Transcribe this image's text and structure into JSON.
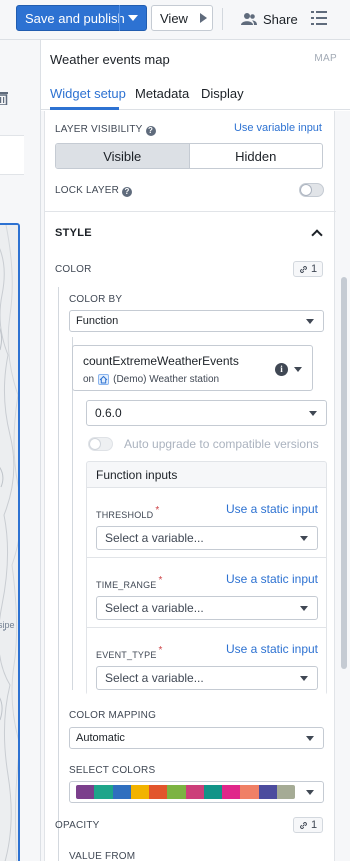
{
  "toolbar": {
    "save_publish_label": "Save and publish",
    "view_label": "View",
    "share_label": "Share"
  },
  "map": {
    "partial_label": "sipe"
  },
  "panel": {
    "title": "Weather events map",
    "kind": "MAP",
    "tabs": [
      {
        "label": "Widget setup",
        "active": true
      },
      {
        "label": "Metadata",
        "active": false
      },
      {
        "label": "Display",
        "active": false
      }
    ]
  },
  "layer_visibility": {
    "label": "LAYER VISIBILITY",
    "link": "Use variable input",
    "options": [
      "Visible",
      "Hidden"
    ],
    "selected": "Visible"
  },
  "lock_layer": {
    "label": "LOCK LAYER",
    "enabled": false
  },
  "style": {
    "title": "STYLE"
  },
  "color": {
    "label": "COLOR",
    "link_count": "1",
    "color_by_label": "COLOR BY",
    "color_by_value": "Function",
    "function_name": "countExtremeWeatherEvents",
    "function_on": "on",
    "function_object": "(Demo) Weather station",
    "version": "0.6.0",
    "auto_upgrade_label": "Auto upgrade to compatible versions",
    "function_inputs_title": "Function inputs",
    "inputs": [
      {
        "name": "THRESHOLD",
        "link": "Use a static input",
        "placeholder": "Select a variable..."
      },
      {
        "name": "TIME_RANGE",
        "link": "Use a static input",
        "placeholder": "Select a variable..."
      },
      {
        "name": "EVENT_TYPE",
        "link": "Use a static input",
        "placeholder": "Select a variable..."
      }
    ],
    "color_mapping_label": "COLOR MAPPING",
    "color_mapping_value": "Automatic",
    "select_colors_label": "SELECT COLORS",
    "palette": [
      "#7b3f8c",
      "#1ea58a",
      "#2f6fbf",
      "#f2b300",
      "#e2552c",
      "#7cb342",
      "#cc3f7a",
      "#129488",
      "#e0278a",
      "#f08066",
      "#4c4c9e",
      "#a5ab95"
    ]
  },
  "opacity": {
    "label": "OPACITY",
    "link_count": "1",
    "value_from_label": "VALUE FROM"
  }
}
